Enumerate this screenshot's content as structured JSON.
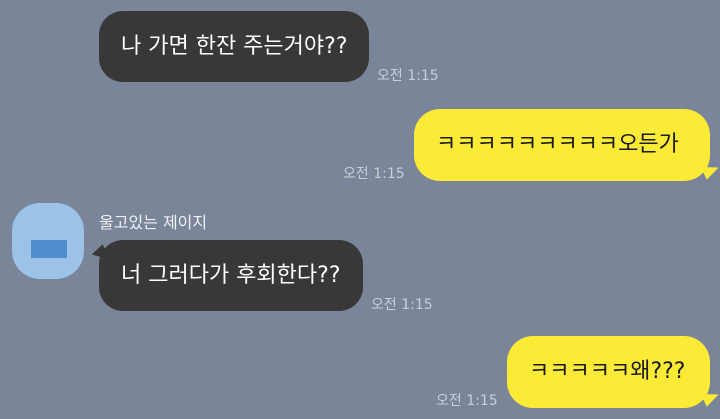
{
  "messages": [
    {
      "direction": "received",
      "text": "나 가면 한잔 주는거야??",
      "time": "오전 1:15"
    },
    {
      "direction": "sent",
      "text": "ㅋㅋㅋㅋㅋㅋㅋㅋㅋ오든가",
      "time": "오전 1:15"
    },
    {
      "direction": "received",
      "sender": "울고있는 제이지",
      "text": "너 그러다가 후회한다??",
      "time": "오전 1:15"
    },
    {
      "direction": "sent",
      "text": "ㅋㅋㅋㅋㅋ왜???",
      "time": "오전 1:15"
    }
  ],
  "colors": {
    "background": "#7a8599",
    "received_bubble": "#383838",
    "sent_bubble": "#fbeb36",
    "avatar": "#9cc2e8"
  }
}
